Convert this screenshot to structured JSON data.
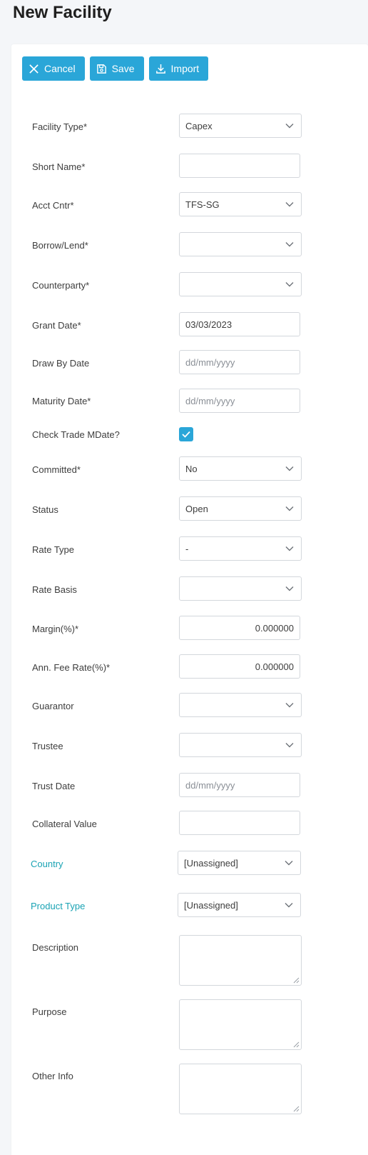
{
  "page": {
    "title": "New Facility"
  },
  "toolbar": {
    "cancel_label": "Cancel",
    "save_label": "Save",
    "import_label": "Import"
  },
  "form": {
    "facility_type": {
      "label": "Facility Type*",
      "value": "Capex"
    },
    "short_name": {
      "label": "Short Name*",
      "value": ""
    },
    "acct_cntr": {
      "label": "Acct Cntr*",
      "value": "TFS-SG"
    },
    "borrow_lend": {
      "label": "Borrow/Lend*",
      "value": ""
    },
    "counterparty": {
      "label": "Counterparty*",
      "value": ""
    },
    "grant_date": {
      "label": "Grant Date*",
      "value": "03/03/2023"
    },
    "draw_by_date": {
      "label": "Draw By Date",
      "placeholder": "dd/mm/yyyy"
    },
    "maturity_date": {
      "label": "Maturity Date*",
      "placeholder": "dd/mm/yyyy"
    },
    "check_trade_mdate": {
      "label": "Check Trade MDate?",
      "checked": true
    },
    "committed": {
      "label": "Committed*",
      "value": "No"
    },
    "status": {
      "label": "Status",
      "value": "Open"
    },
    "rate_type": {
      "label": "Rate Type",
      "value": "-"
    },
    "rate_basis": {
      "label": "Rate Basis",
      "value": ""
    },
    "margin": {
      "label": "Margin(%)*",
      "value": "0.000000"
    },
    "ann_fee_rate": {
      "label": "Ann. Fee Rate(%)*",
      "value": "0.000000"
    },
    "guarantor": {
      "label": "Guarantor",
      "value": ""
    },
    "trustee": {
      "label": "Trustee",
      "value": ""
    },
    "trust_date": {
      "label": "Trust Date",
      "placeholder": "dd/mm/yyyy"
    },
    "collateral_value": {
      "label": "Collateral Value",
      "value": ""
    },
    "country": {
      "label": "Country",
      "value": "[Unassigned]"
    },
    "product_type": {
      "label": "Product Type",
      "value": "[Unassigned]"
    },
    "description": {
      "label": "Description",
      "value": ""
    },
    "purpose": {
      "label": "Purpose",
      "value": ""
    },
    "other_info": {
      "label": "Other Info",
      "value": ""
    }
  },
  "colors": {
    "accent": "#2aa6d8",
    "link": "#1aa3b4",
    "background": "#f4f6f9"
  },
  "icons": {
    "cancel": "close-icon",
    "save": "floppy-disk-icon",
    "import": "download-icon",
    "select": "chevron-down-icon"
  }
}
